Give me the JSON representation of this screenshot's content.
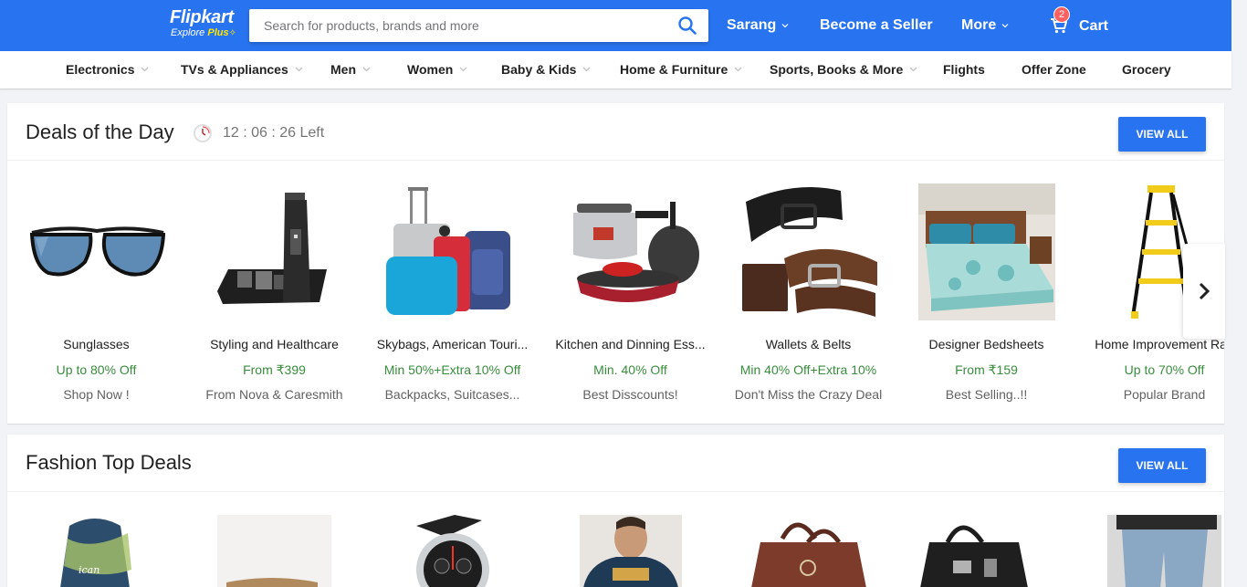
{
  "header": {
    "logo_text": "Flipkart",
    "logo_tagline_1": "Explore",
    "logo_tagline_2": "Plus",
    "search_placeholder": "Search for products, brands and more",
    "user_label": "Sarang",
    "seller_label": "Become a Seller",
    "more_label": "More",
    "cart_label": "Cart",
    "cart_count": "2",
    "colors": {
      "brand": "#2874f0",
      "brand_yellow": "#ffe500",
      "badge": "#ff6161"
    }
  },
  "categories": [
    {
      "label": "Electronics",
      "has_dropdown": true
    },
    {
      "label": "TVs & Appliances",
      "has_dropdown": true
    },
    {
      "label": "Men",
      "has_dropdown": true
    },
    {
      "label": "Women",
      "has_dropdown": true
    },
    {
      "label": "Baby & Kids",
      "has_dropdown": true
    },
    {
      "label": "Home & Furniture",
      "has_dropdown": true
    },
    {
      "label": "Sports, Books & More",
      "has_dropdown": true
    },
    {
      "label": "Flights",
      "has_dropdown": false
    },
    {
      "label": "Offer Zone",
      "has_dropdown": false
    },
    {
      "label": "Grocery",
      "has_dropdown": false
    }
  ],
  "deals": {
    "title": "Deals of the Day",
    "timer": "12 : 06 : 26 Left",
    "view_all": "VIEW ALL",
    "items": [
      {
        "name": "Sunglasses",
        "offer": "Up to 80% Off",
        "sub": "Shop Now !",
        "icon": "sunglasses-image"
      },
      {
        "name": "Styling and Healthcare",
        "offer": "From ₹399",
        "sub": "From Nova & Caresmith",
        "icon": "trimmer-image"
      },
      {
        "name": "Skybags, American Touri...",
        "offer": "Min 50%+Extra 10% Off",
        "sub": "Backpacks, Suitcases...",
        "icon": "luggage-image"
      },
      {
        "name": "Kitchen and Dinning Ess...",
        "offer": "Min. 40% Off",
        "sub": "Best Disscounts!",
        "icon": "cookware-image"
      },
      {
        "name": "Wallets & Belts",
        "offer": "Min 40% Off+Extra 10%",
        "sub": "Don't Miss the Crazy Deal",
        "icon": "belts-image"
      },
      {
        "name": "Designer Bedsheets",
        "offer": "From ₹159",
        "sub": "Best Selling..!!",
        "icon": "bedsheet-image"
      },
      {
        "name": "Home Improvement Ran",
        "offer": "Up to 70% Off",
        "sub": "Popular Brand",
        "icon": "ladder-image"
      }
    ]
  },
  "fashion": {
    "title": "Fashion Top Deals",
    "view_all": "VIEW ALL",
    "items": [
      {
        "icon": "backpack-image"
      },
      {
        "icon": "shoe-image"
      },
      {
        "icon": "watch-image"
      },
      {
        "icon": "tshirt-image"
      },
      {
        "icon": "handbag-brown-image"
      },
      {
        "icon": "handbag-black-image"
      },
      {
        "icon": "jeans-image"
      }
    ]
  }
}
